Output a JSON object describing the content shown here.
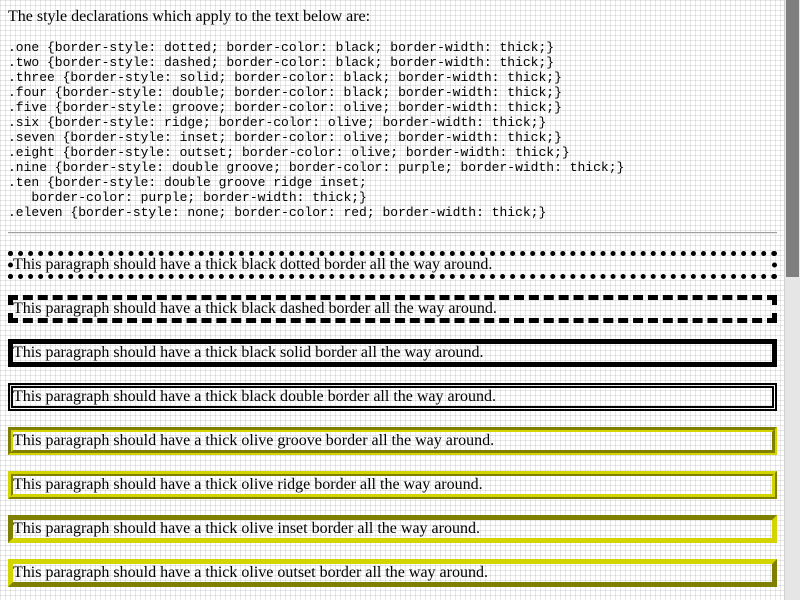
{
  "intro_text": "The style declarations which apply to the text below are:",
  "css_rules": ".one {border-style: dotted; border-color: black; border-width: thick;}\n.two {border-style: dashed; border-color: black; border-width: thick;}\n.three {border-style: solid; border-color: black; border-width: thick;}\n.four {border-style: double; border-color: black; border-width: thick;}\n.five {border-style: groove; border-color: olive; border-width: thick;}\n.six {border-style: ridge; border-color: olive; border-width: thick;}\n.seven {border-style: inset; border-color: olive; border-width: thick;}\n.eight {border-style: outset; border-color: olive; border-width: thick;}\n.nine {border-style: double groove; border-color: purple; border-width: thick;}\n.ten {border-style: double groove ridge inset;\n   border-color: purple; border-width: thick;}\n.eleven {border-style: none; border-color: red; border-width: thick;}",
  "paragraphs": {
    "one": "This paragraph should have a thick black dotted border all the way around.",
    "two": "This paragraph should have a thick black dashed border all the way around.",
    "three": "This paragraph should have a thick black solid border all the way around.",
    "four": "This paragraph should have a thick black double border all the way around.",
    "five": "This paragraph should have a thick olive groove border all the way around.",
    "six": "This paragraph should have a thick olive ridge border all the way around.",
    "seven": "This paragraph should have a thick olive inset border all the way around.",
    "eight": "This paragraph should have a thick olive outset border all the way around."
  },
  "colors": {
    "border_black": "#000000",
    "border_olive": "#d4d400",
    "scrollbar_track": "#e6e6e6",
    "scrollbar_thumb": "#7f7f7f"
  }
}
